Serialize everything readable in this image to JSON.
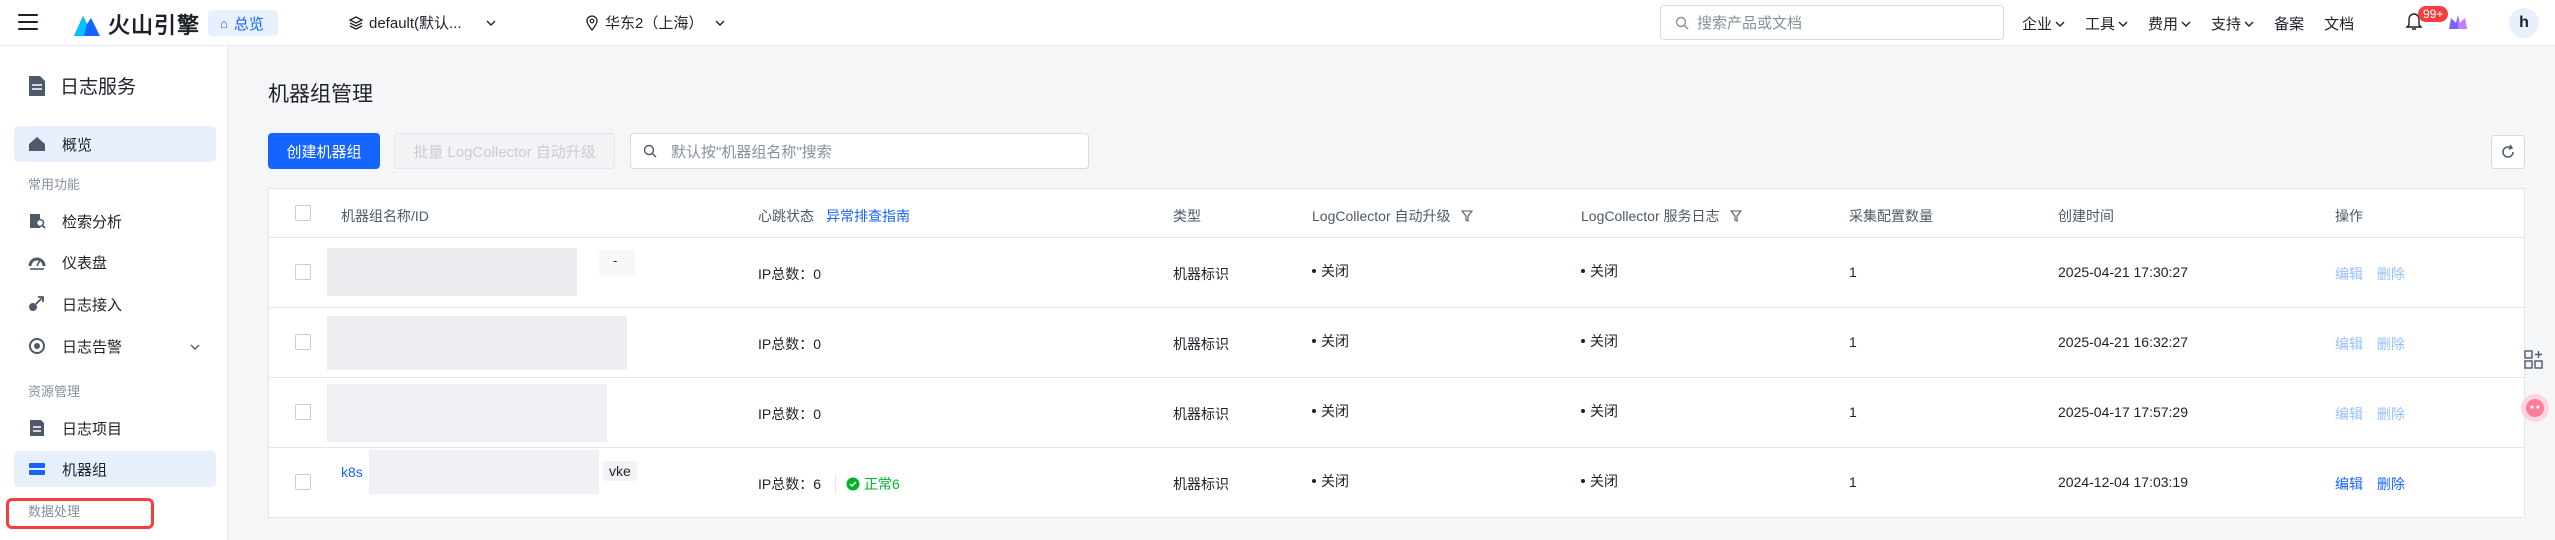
{
  "header": {
    "logo_text": "火山引擎",
    "home_chip": "总览",
    "project": "default(默认...",
    "region": "华东2（上海）",
    "search_placeholder": "搜索产品或文档",
    "nav": [
      "企业",
      "工具",
      "费用",
      "支持",
      "备案",
      "文档"
    ],
    "notification_badge": "99+",
    "avatar_letter": "h"
  },
  "sidebar": {
    "title": "日志服务",
    "items": [
      {
        "label": "概览",
        "icon": "home-icon",
        "active": true
      },
      {
        "group": "常用功能"
      },
      {
        "label": "检索分析",
        "icon": "search-analysis-icon"
      },
      {
        "label": "仪表盘",
        "icon": "dashboard-icon"
      },
      {
        "label": "日志接入",
        "icon": "log-ingest-icon"
      },
      {
        "label": "日志告警",
        "icon": "alarm-icon"
      },
      {
        "group": "资源管理"
      },
      {
        "label": "日志项目",
        "icon": "log-project-icon"
      },
      {
        "label": "机器组",
        "icon": "machine-group-icon",
        "selected": true
      },
      {
        "group": "数据处理"
      }
    ]
  },
  "main": {
    "title": "机器组管理",
    "create_button": "创建机器组",
    "batch_button": "批量 LogCollector 自动升级",
    "search_placeholder": "默认按\"机器组名称\"搜索",
    "columns": [
      "机器组名称/ID",
      "心跳状态",
      "异常排查指南",
      "类型",
      "LogCollector 自动升级",
      "LogCollector 服务日志",
      "采集配置数量",
      "创建时间",
      "操作"
    ],
    "rows": [
      {
        "name": "",
        "name_tag": "-",
        "heartbeat": "IP总数：0",
        "status": "",
        "type": "机器标识",
        "auto_upgrade": "关闭",
        "service_log": "关闭",
        "config_count": "1",
        "created": "2025-04-21 17:30:27",
        "edit": "编辑",
        "delete": "删除",
        "ops_enabled": false
      },
      {
        "name": "",
        "name_tag": "",
        "heartbeat": "IP总数：0",
        "status": "",
        "type": "机器标识",
        "auto_upgrade": "关闭",
        "service_log": "关闭",
        "config_count": "1",
        "created": "2025-04-21 16:32:27",
        "edit": "编辑",
        "delete": "删除",
        "ops_enabled": false
      },
      {
        "name": "",
        "name_tag": "",
        "heartbeat": "IP总数：0",
        "status": "",
        "type": "机器标识",
        "auto_upgrade": "关闭",
        "service_log": "关闭",
        "config_count": "1",
        "created": "2025-04-17 17:57:29",
        "edit": "编辑",
        "delete": "删除",
        "ops_enabled": false
      },
      {
        "name": "k8s",
        "name_tag": "vke",
        "heartbeat": "IP总数：6",
        "status": "正常6",
        "type": "机器标识",
        "auto_upgrade": "关闭",
        "service_log": "关闭",
        "config_count": "1",
        "created": "2024-12-04 17:03:19",
        "edit": "编辑",
        "delete": "删除",
        "ops_enabled": true
      }
    ]
  },
  "colors": {
    "primary": "#1664ff",
    "success": "#00b42a",
    "highlight": "#f53f3f"
  }
}
